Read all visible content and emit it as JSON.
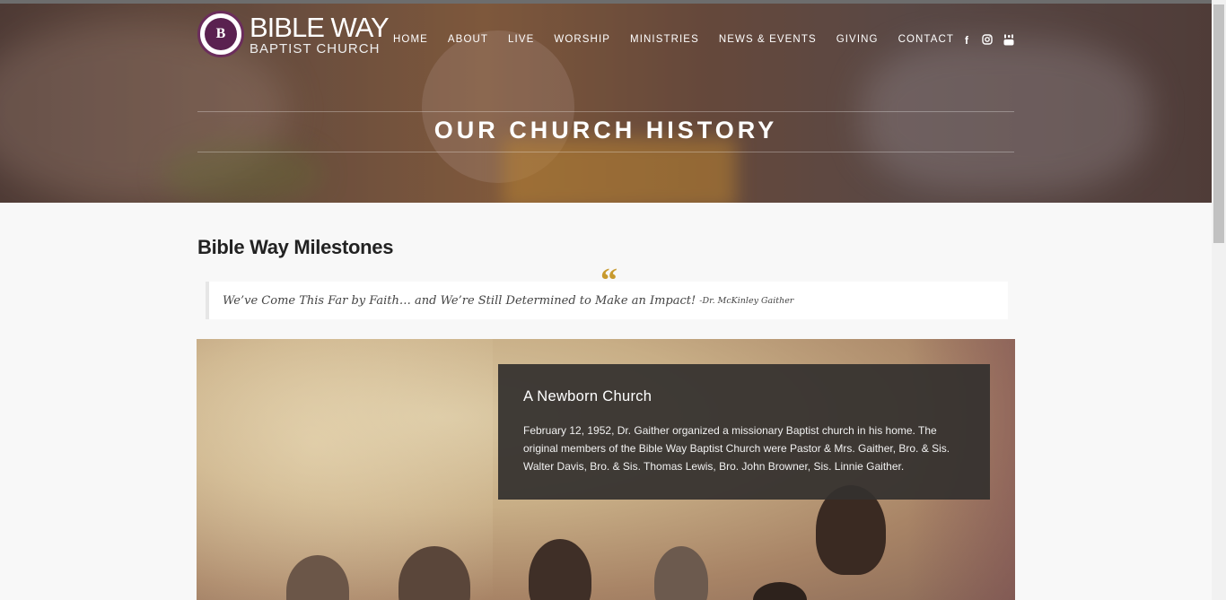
{
  "brand": {
    "name_line1": "BIBLE WAY",
    "name_line2": "BAPTIST CHURCH",
    "badge_text": "B",
    "primary_color": "#5a2150"
  },
  "nav": {
    "items": [
      {
        "label": "HOME"
      },
      {
        "label": "ABOUT"
      },
      {
        "label": "LIVE"
      },
      {
        "label": "WORSHIP"
      },
      {
        "label": "MINISTRIES"
      },
      {
        "label": "NEWS & EVENTS"
      },
      {
        "label": "GIVING"
      },
      {
        "label": "CONTACT"
      }
    ],
    "social": {
      "facebook_glyph": "f",
      "icons": [
        "facebook-icon",
        "instagram-icon",
        "youtube-icon"
      ]
    }
  },
  "hero": {
    "title": "OUR CHURCH HISTORY"
  },
  "content": {
    "heading": "Bible Way Milestones",
    "quote_mark": "“",
    "quote": "We’ve Come This Far by Faith… and We’re Still Determined to Make an Impact!",
    "quote_author": "-Dr. McKinley Gaither",
    "accent_color": "#c89a2e"
  },
  "milestone": {
    "title": "A Newborn Church",
    "body": "February 12, 1952, Dr. Gaither organized a missionary Baptist church in his home. The original members of the Bible Way Baptist Church were Pastor & Mrs. Gaither, Bro. & Sis. Walter Davis, Bro. & Sis. Thomas Lewis, Bro. John Browner, Sis. Linnie Gaither."
  }
}
